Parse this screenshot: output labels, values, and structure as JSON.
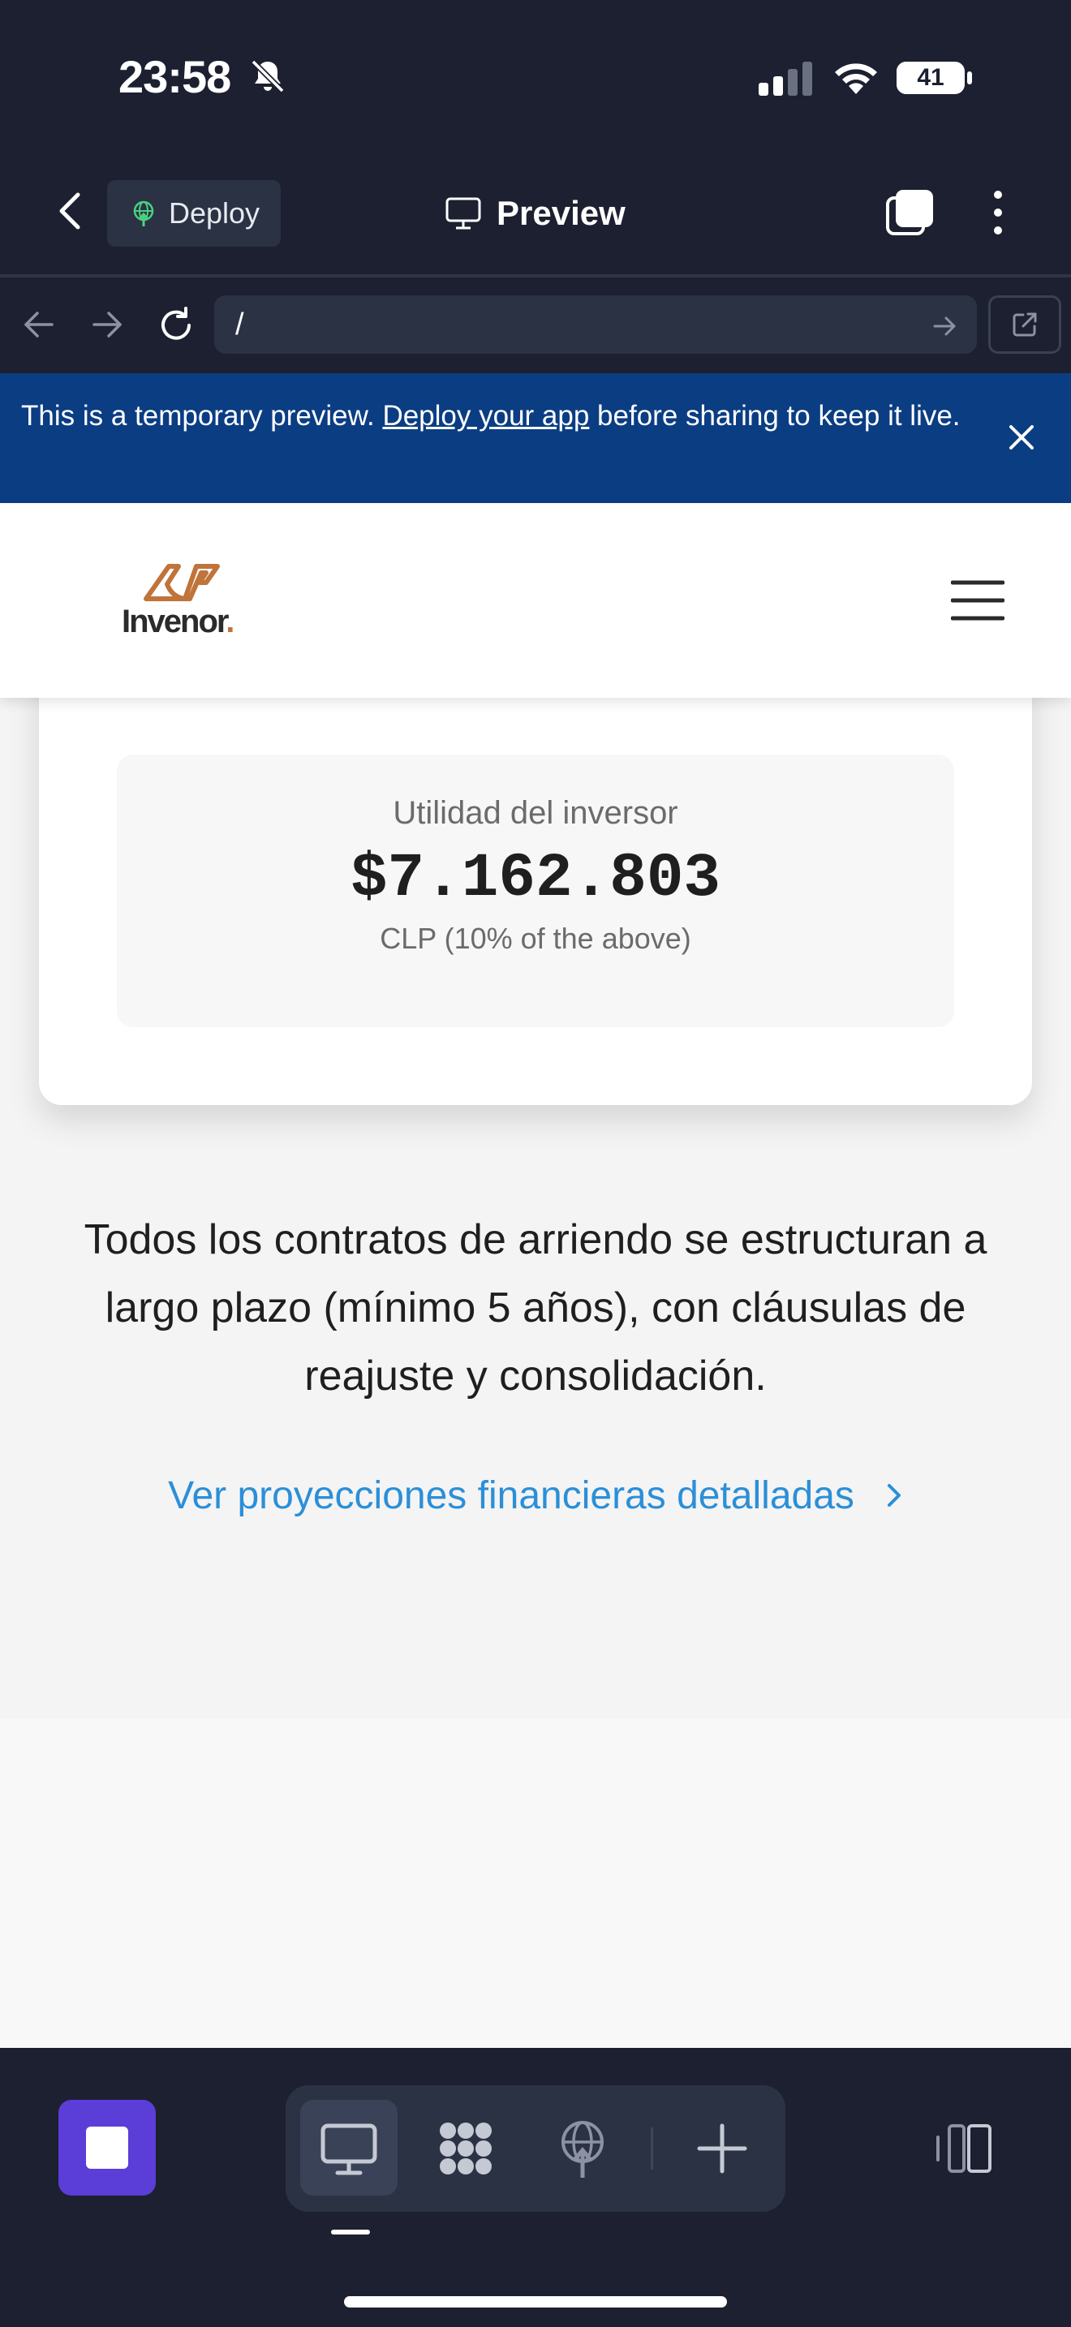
{
  "status_bar": {
    "time": "23:58",
    "battery": "41"
  },
  "header": {
    "deploy_label": "Deploy",
    "title": "Preview"
  },
  "browser": {
    "url": "/"
  },
  "banner": {
    "text_before": "This is a temporary preview. ",
    "link_text": "Deploy your app",
    "text_after": " before sharing to keep it live."
  },
  "site": {
    "logo_text": "Invenor",
    "logo_dot": ".",
    "metric": {
      "label": "Utilidad del inversor",
      "value": "$7.162.803",
      "sub": "CLP (10% of the above)"
    },
    "body_text": "Todos los contratos de arriendo se estructuran a largo plazo (mínimo 5 años), con cláusulas de reajuste y consolidación.",
    "projections_link": "Ver proyecciones financieras detalladas"
  },
  "icons": {
    "bell_muted": "bell-slash-icon",
    "signal": "cellular-signal-icon",
    "wifi": "wifi-icon",
    "back": "chevron-left-icon",
    "deploy": "globe-upload-icon",
    "monitor": "monitor-icon",
    "tabs": "tabs-icon",
    "more": "vertical-ellipsis-icon",
    "close": "close-icon",
    "menu": "hamburger-menu-icon",
    "chevron_right": "chevron-right-icon",
    "apps": "grid-apps-icon",
    "plus": "plus-icon",
    "panel": "split-panel-icon"
  },
  "colors": {
    "app_bg": "#1c2030",
    "banner_bg": "#0b3d83",
    "link_blue": "#2b8fd8",
    "stop_button": "#5b3dd8",
    "logo_accent": "#c0743a"
  }
}
